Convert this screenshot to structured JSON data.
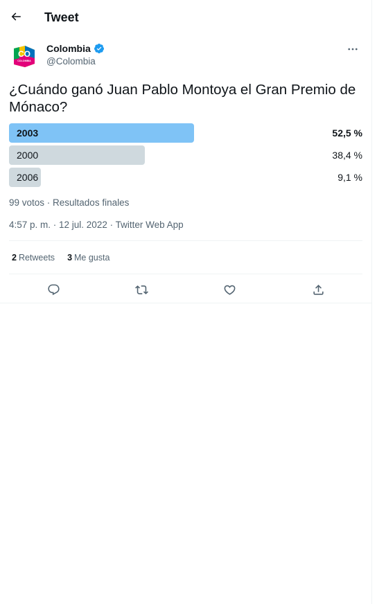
{
  "header": {
    "title": "Tweet",
    "back_icon": "arrow-left-icon"
  },
  "author": {
    "name": "Colombia",
    "handle": "@Colombia",
    "verified": true,
    "verified_color": "#1d9bf0",
    "avatar_text": "CO",
    "avatar_subtext": "COLOMBIA"
  },
  "tweet": {
    "text": "¿Cuándo ganó Juan Pablo Montoya el Gran Premio de Mónaco?"
  },
  "poll": {
    "options": [
      {
        "label": "2003",
        "percent_label": "52,5 %",
        "percent": 52.5,
        "winner": true
      },
      {
        "label": "2000",
        "percent_label": "38,4 %",
        "percent": 38.4,
        "winner": false
      },
      {
        "label": "2006",
        "percent_label": "9,1 %",
        "percent": 9.1,
        "winner": false
      }
    ],
    "meta": "99 votos · Resultados finales",
    "winner_color": "#7fc3f6",
    "other_color": "#cfd9de"
  },
  "timestamp": "4:57 p. m. · 12 jul. 2022 · Twitter Web App",
  "stats": {
    "retweets_count": "2",
    "retweets_label": "Retweets",
    "likes_count": "3",
    "likes_label": "Me gusta"
  },
  "actions": [
    "reply-icon",
    "retweet-icon",
    "like-icon",
    "share-icon"
  ]
}
